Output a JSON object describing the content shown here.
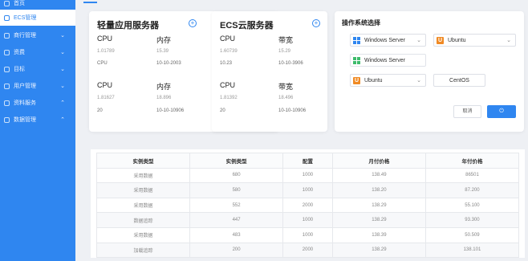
{
  "sidebar": {
    "items": [
      {
        "label": "首页",
        "chevron": ""
      },
      {
        "label": "ECS管理",
        "chevron": ""
      },
      {
        "label": "商行管理",
        "chevron": "⌄"
      },
      {
        "label": "资费",
        "chevron": "⌄"
      },
      {
        "label": "目标",
        "chevron": "⌄"
      },
      {
        "label": "用户管理",
        "chevron": "⌄"
      },
      {
        "label": "资料服务",
        "chevron": "⌃"
      },
      {
        "label": "数据管理",
        "chevron": "⌃"
      }
    ]
  },
  "cards": {
    "lightweight": {
      "title": "轻量应用服务器",
      "col1_label": "CPU",
      "col2_label": "内存",
      "row1": {
        "a": "1.01789",
        "b": "15.39",
        "c": "CPU",
        "d": "10-10-2003"
      },
      "col1_label_2": "CPU",
      "col2_label_2": "内存",
      "row2": {
        "a": "1.81627",
        "b": "18.896",
        "c": "20",
        "d": "10-10-10906"
      }
    },
    "ecs": {
      "title": "ECS云服务器",
      "col1_label": "CPU",
      "col2_label": "带宽",
      "row1": {
        "a": "1.60739",
        "b": "15.29",
        "c": "10.23",
        "d": "10-10-3906"
      },
      "col1_label_2": "CPU",
      "col2_label_2": "带宽",
      "row2": {
        "a": "1.81392",
        "b": "18.496",
        "c": "20",
        "d": "10-10-10906"
      }
    },
    "os": {
      "title": "操作系统选择",
      "select1": "Windows Server",
      "select2": "Ubuntu",
      "select3": "Windows Server",
      "select4": "Ubuntu",
      "centos": "CentOS",
      "cancel_label": "取消",
      "confirm_label": "⏻"
    }
  },
  "table": {
    "headers": [
      "实例类型",
      "实例类型",
      "配置",
      "月付价格",
      "年付价格"
    ],
    "rows": [
      [
        "采用数据",
        "680",
        "1000",
        "138.49",
        "86501"
      ],
      [
        "采用数据",
        "580",
        "1000",
        "138.20",
        "87.200"
      ],
      [
        "采用数据",
        "552",
        "2000",
        "138.29",
        "55.100"
      ],
      [
        "数据追踪",
        "447",
        "1000",
        "138.29",
        "93.300"
      ],
      [
        "采用数据",
        "483",
        "1000",
        "138.39",
        "50.509"
      ],
      [
        "加载追踪",
        "200",
        "2000",
        "138.29",
        "138.101"
      ]
    ]
  },
  "colors": {
    "accent": "#2f86f0",
    "ubuntu": "#f08a24",
    "windows_alt": "#3dbb6b"
  }
}
